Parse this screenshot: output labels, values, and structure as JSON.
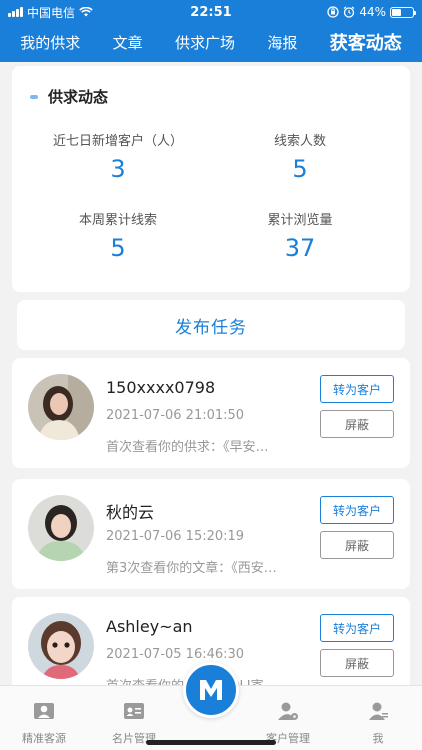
{
  "status_bar": {
    "carrier": "中国电信",
    "time": "22:51",
    "battery": "44%",
    "battery_level": 0.44
  },
  "nav": {
    "tabs": [
      {
        "label": "我的供求",
        "active": false
      },
      {
        "label": "文章",
        "active": false
      },
      {
        "label": "供求广场",
        "active": false
      },
      {
        "label": "海报",
        "active": false
      },
      {
        "label": "获客动态",
        "active": true
      }
    ]
  },
  "stats": {
    "title": "供求动态",
    "items": [
      {
        "label": "近七日新增客户（人）",
        "value": "3"
      },
      {
        "label": "线索人数",
        "value": "5"
      },
      {
        "label": "本周累计线索",
        "value": "5"
      },
      {
        "label": "累计浏览量",
        "value": "37"
      }
    ]
  },
  "publish_label": "发布任务",
  "leads": [
    {
      "name": "150xxxx0798",
      "time": "2021-07-06 21:01:50",
      "desc": "首次查看你的供求：《早安…",
      "convert_label": "转为客户",
      "block_label": "屏蔽"
    },
    {
      "name": "秋的云",
      "time": "2021-07-06 15:20:19",
      "desc": "第3次查看你的文章：《西安…",
      "convert_label": "转为客户",
      "block_label": "屏蔽"
    },
    {
      "name": "Ashley~an",
      "time": "2021-07-05 16:46:30",
      "desc": "首次查看你的供求：《DLI寄…",
      "convert_label": "转为客户",
      "block_label": "屏蔽"
    }
  ],
  "bottom_nav": {
    "items": [
      {
        "label": "精准客源",
        "icon": "user-card-icon"
      },
      {
        "label": "名片管理",
        "icon": "id-card-icon"
      },
      {
        "label": "",
        "icon": "logo-m-icon"
      },
      {
        "label": "客户管理",
        "icon": "user-settings-icon"
      },
      {
        "label": "我",
        "icon": "person-icon"
      }
    ]
  },
  "colors": {
    "primary": "#1a7fd9",
    "background": "#f2f2f2"
  }
}
